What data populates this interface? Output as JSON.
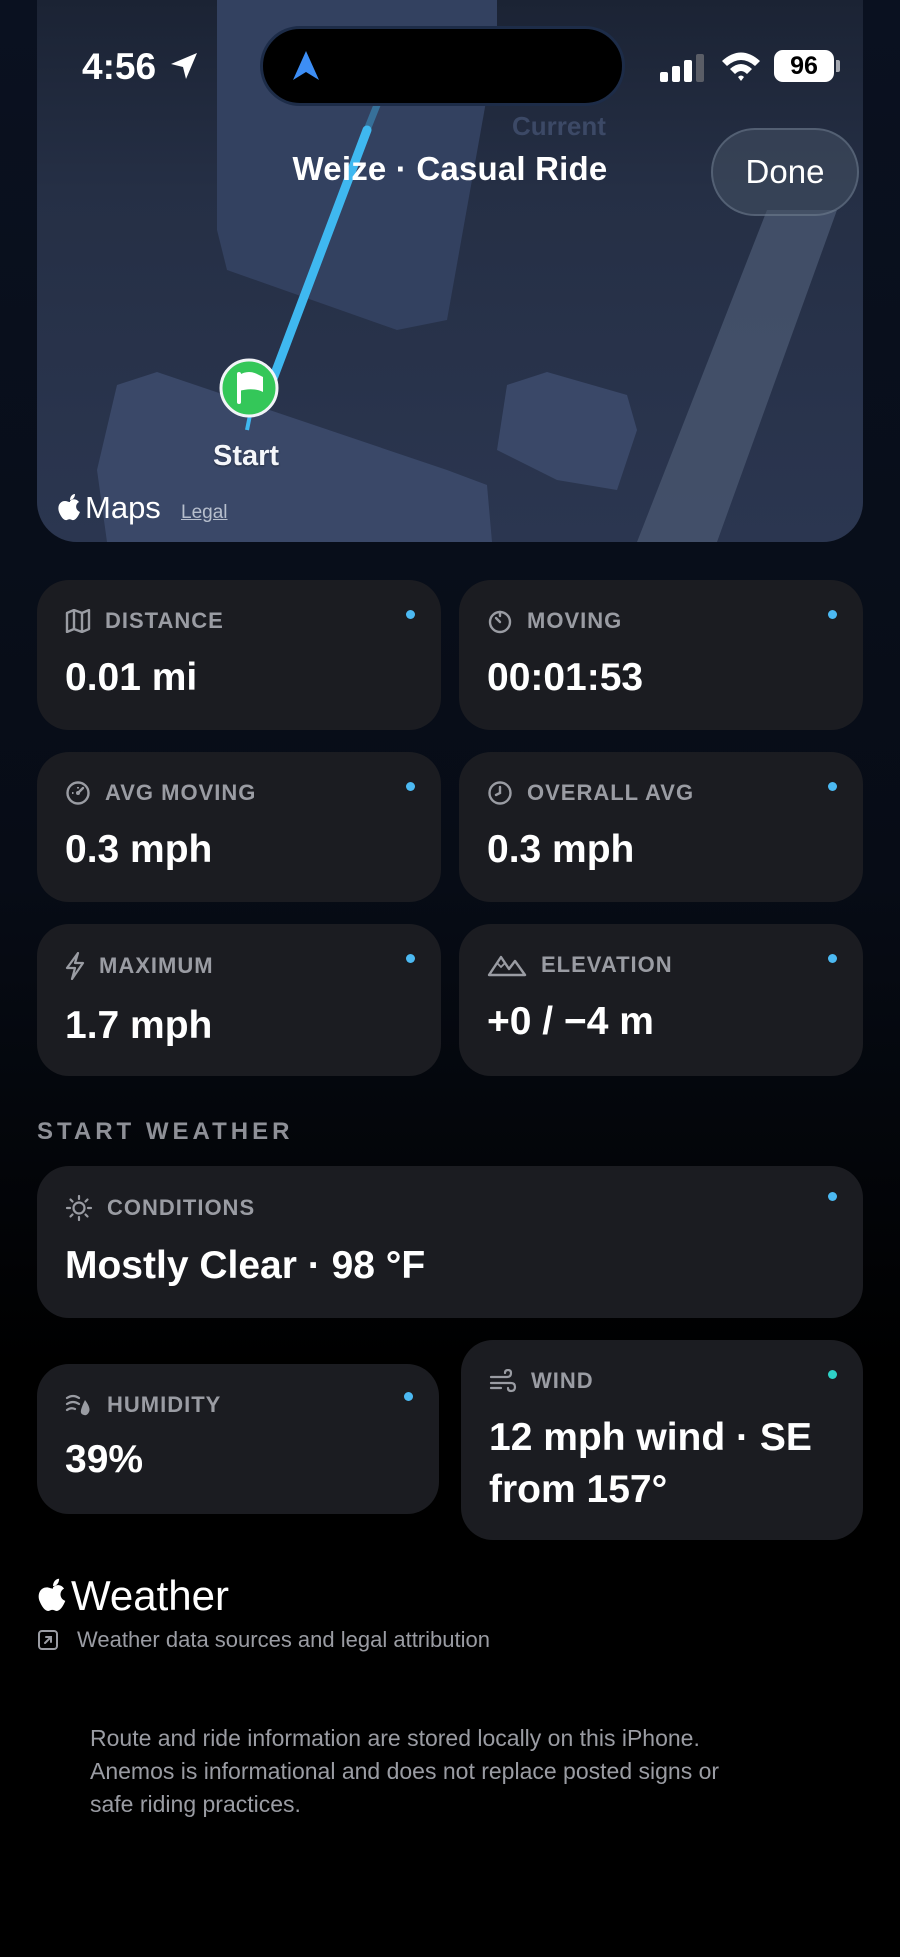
{
  "status_bar": {
    "time": "4:56",
    "battery": "96"
  },
  "map": {
    "title": "Weize · Casual Ride",
    "done_label": "Done",
    "start_label": "Start",
    "maps_brand": "Maps",
    "legal_label": "Legal"
  },
  "metrics": {
    "distance": {
      "label": "DISTANCE",
      "value": "0.01 mi"
    },
    "moving": {
      "label": "MOVING",
      "value": "00:01:53"
    },
    "avg_moving": {
      "label": "AVG MOVING",
      "value": "0.3 mph"
    },
    "overall_avg": {
      "label": "OVERALL AVG",
      "value": "0.3 mph"
    },
    "maximum": {
      "label": "MAXIMUM",
      "value": "1.7 mph"
    },
    "elevation": {
      "label": "ELEVATION",
      "value": "+0 / −4 m"
    }
  },
  "weather": {
    "section_title": "START WEATHER",
    "conditions": {
      "label": "CONDITIONS",
      "value": "Mostly Clear · 98 °F"
    },
    "humidity": {
      "label": "HUMIDITY",
      "value": "39%"
    },
    "wind": {
      "label": "WIND",
      "value_line1": "12 mph wind · SE",
      "value_line2": "from 157°"
    },
    "brand": "Weather",
    "attribution_link": "Weather data sources and legal attribution"
  },
  "disclaimer": {
    "line1": "Route and ride information are stored locally on this iPhone.",
    "line2": "Anemos is informational and does not replace posted signs or",
    "line3": "safe riding practices."
  },
  "colors": {
    "accent_blue": "#4cb9f2",
    "accent_teal": "#2ed1c7",
    "card_bg": "#1b1c21",
    "route": "#3fb8f0",
    "start_marker": "#34c759"
  }
}
